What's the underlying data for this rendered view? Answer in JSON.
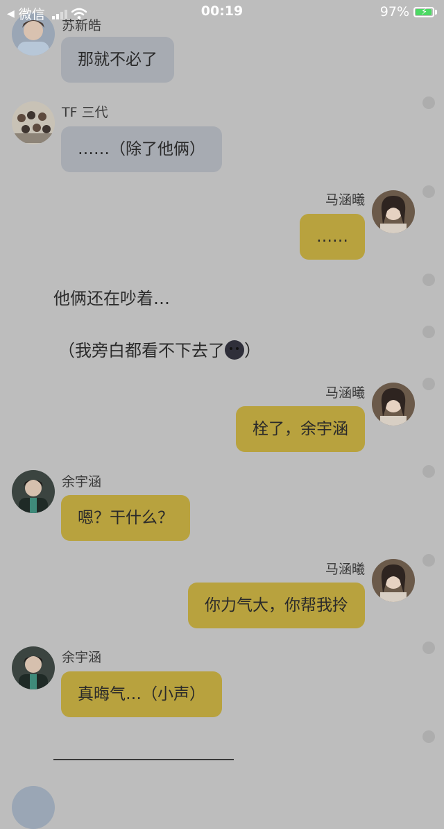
{
  "status_bar": {
    "back_app": "微信",
    "time": "00:19",
    "battery": "97%"
  },
  "messages": [
    {
      "name": "苏新皓",
      "text": "那就不必了"
    },
    {
      "name": "TF 三代",
      "text": "……（除了他俩）"
    },
    {
      "name": "马涵曦",
      "text": "……"
    },
    {
      "name": "",
      "text": "他俩还在吵着…"
    },
    {
      "name": "",
      "text": "（我旁白都看不下去了"
    },
    {
      "name": "马涵曦",
      "text": "栓了，余宇涵"
    },
    {
      "name": "余宇涵",
      "text": "嗯？干什么？"
    },
    {
      "name": "马涵曦",
      "text": "你力气大，你帮我拎"
    },
    {
      "name": "余宇涵",
      "text": "真晦气…（小声）"
    }
  ],
  "narration": {
    "line1": "他俩还在吵着…",
    "line2_prefix": "（我旁白都看不下去了",
    "line2_emoji": "new-moon-face-emoji",
    "line2_suffix": "）"
  },
  "colors": {
    "left_bubble": "#a7abb2",
    "right_bubble": "#b8a23e",
    "background": "#bdbdbd"
  }
}
